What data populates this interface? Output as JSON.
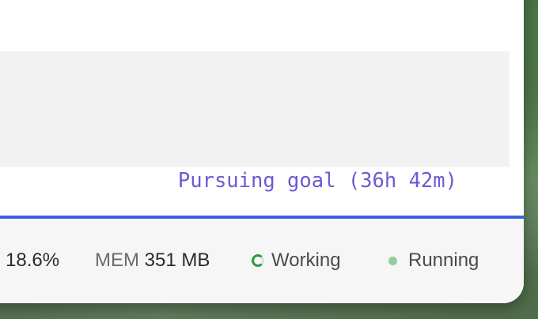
{
  "goal": {
    "text": "Pursuing goal (36h 42m)"
  },
  "status": {
    "cpu_value": "18.6%",
    "mem_label": "MEM",
    "mem_value": "351 MB",
    "working_label": "Working",
    "running_label": "Running"
  },
  "colors": {
    "goal_text": "#6b5bd2",
    "progress_line": "#3d5fe6",
    "working_spinner": "#2f9a3f",
    "running_dot": "#8fcf98"
  },
  "icons": {
    "working": "spinner-icon",
    "running": "status-dot-icon"
  }
}
